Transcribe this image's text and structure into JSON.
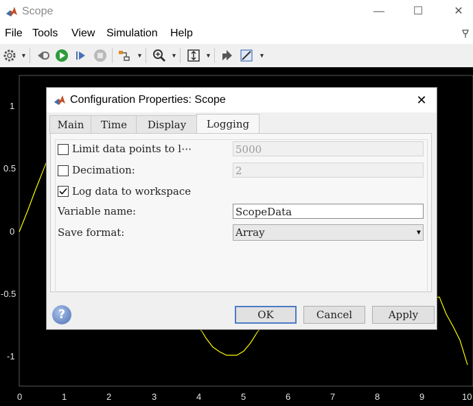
{
  "window": {
    "title": "Scope"
  },
  "window_controls": {
    "minimize": "—",
    "maximize": "☐",
    "close": "✕"
  },
  "menu": [
    "File",
    "Tools",
    "View",
    "Simulation",
    "Help"
  ],
  "toolbar": {
    "icons": [
      "gear-icon",
      "step-back-icon",
      "run-icon",
      "step-forward-icon",
      "stop-icon",
      "highlight-block-icon",
      "zoom-icon",
      "scale-axes-icon",
      "restore-view-icon",
      "measurement-icon"
    ]
  },
  "scope": {
    "background": "#000000",
    "trace_color": "#ffff00",
    "y_ticks": [
      "1",
      "0.5",
      "0",
      "-0.5",
      "-1"
    ],
    "x_ticks": [
      "0",
      "1",
      "2",
      "3",
      "4",
      "5",
      "6",
      "7",
      "8",
      "9",
      "10"
    ]
  },
  "dialog": {
    "title": "Configuration Properties: Scope",
    "close": "✕",
    "tabs": [
      "Main",
      "Time",
      "Display",
      "Logging"
    ],
    "active_tab": "Logging",
    "limit_data_points": {
      "label": "Limit data points to l⋯",
      "checked": false,
      "value": "5000"
    },
    "decimation": {
      "label": "Decimation:",
      "checked": false,
      "value": "2"
    },
    "log_to_workspace": {
      "label": "Log data to workspace",
      "checked": true
    },
    "variable_name": {
      "label": "Variable name:",
      "value": "ScopeData"
    },
    "save_format": {
      "label": "Save format:",
      "value": "Array"
    },
    "help": "?",
    "buttons": {
      "ok": "OK",
      "cancel": "Cancel",
      "apply": "Apply"
    }
  }
}
